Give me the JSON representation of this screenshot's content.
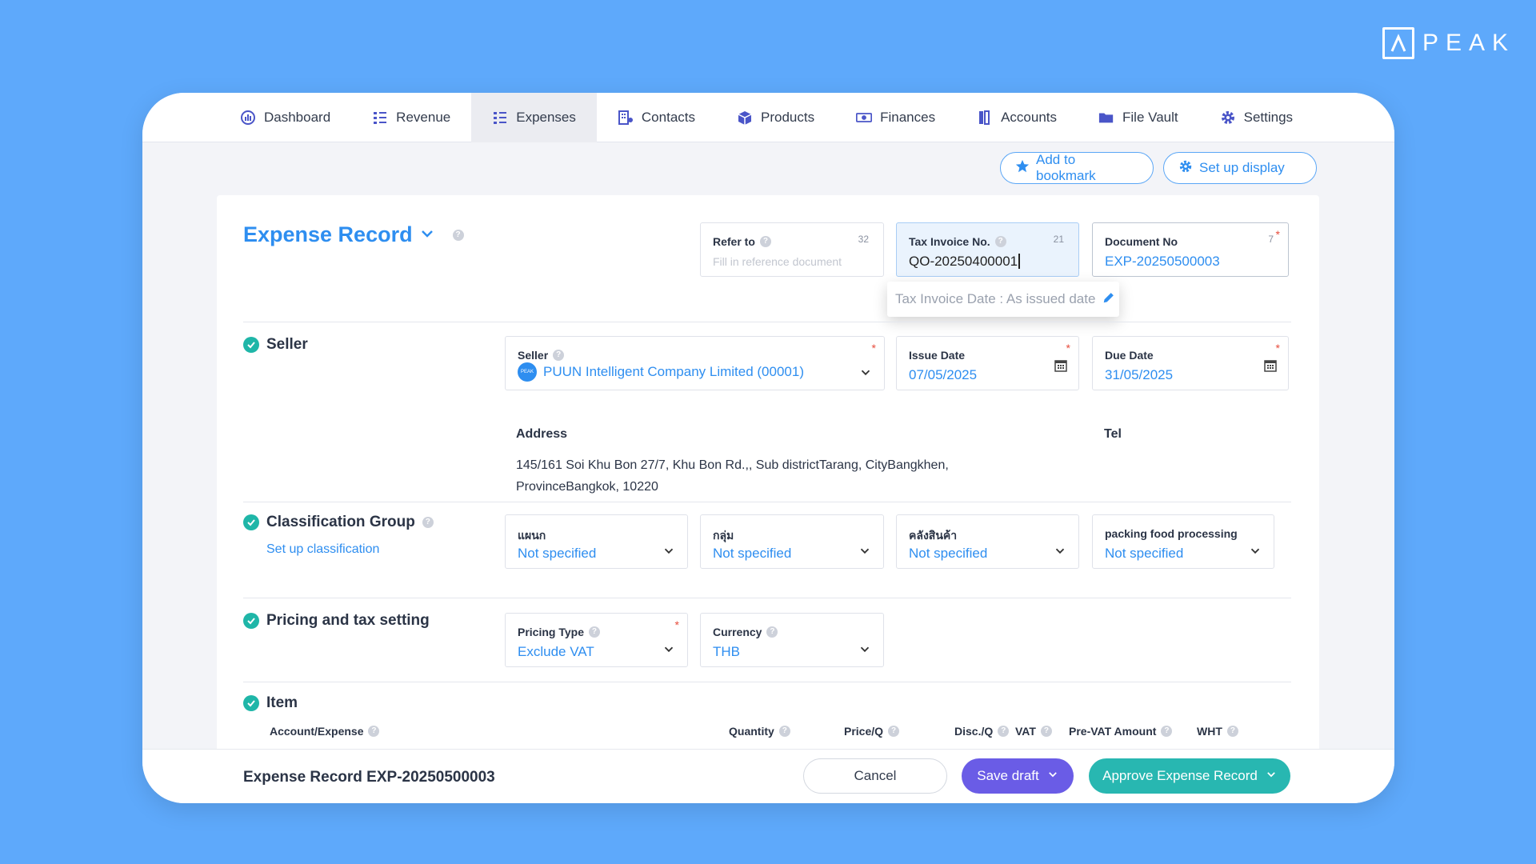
{
  "brand": {
    "logo_text": "PEAK"
  },
  "nav": {
    "items": [
      {
        "label": "Dashboard",
        "icon": "dashboard-icon"
      },
      {
        "label": "Revenue",
        "icon": "revenue-icon"
      },
      {
        "label": "Expenses",
        "icon": "expenses-icon",
        "active": true
      },
      {
        "label": "Contacts",
        "icon": "contacts-icon"
      },
      {
        "label": "Products",
        "icon": "products-icon"
      },
      {
        "label": "Finances",
        "icon": "finances-icon"
      },
      {
        "label": "Accounts",
        "icon": "accounts-icon"
      },
      {
        "label": "File Vault",
        "icon": "folder-icon"
      },
      {
        "label": "Settings",
        "icon": "gear-icon"
      }
    ]
  },
  "toolbar": {
    "bookmark_label": "Add to bookmark",
    "display_label": "Set up display"
  },
  "form": {
    "title": "Expense Record",
    "refer_to": {
      "label": "Refer to",
      "count": "32",
      "placeholder": "Fill in reference document"
    },
    "tax_invoice": {
      "label": "Tax Invoice No.",
      "count": "21",
      "value": "QO-20250400001"
    },
    "document_no": {
      "label": "Document No",
      "count": "7",
      "value": "EXP-20250500003"
    },
    "tooltip": "Tax Invoice Date : As issued date",
    "seller": {
      "section_label": "Seller",
      "field_label": "Seller",
      "avatar_text": "PEAK",
      "value": "PUUN Intelligent Company Limited (00001)"
    },
    "issue_date": {
      "label": "Issue Date",
      "value": "07/05/2025"
    },
    "due_date": {
      "label": "Due Date",
      "value": "31/05/2025"
    },
    "address": {
      "label": "Address",
      "line1": "145/161 Soi Khu Bon 27/7, Khu Bon Rd.,, Sub districtTarang, CityBangkhen,",
      "line2": "ProvinceBangkok, 10220"
    },
    "tel_label": "Tel",
    "classification": {
      "section_label": "Classification Group",
      "setup_link": "Set up classification",
      "groups": [
        {
          "label": "แผนก",
          "value": "Not specified"
        },
        {
          "label": "กลุ่ม",
          "value": "Not specified"
        },
        {
          "label": "คลังสินค้า",
          "value": "Not specified"
        },
        {
          "label": "packing food processing",
          "value": "Not specified"
        }
      ]
    },
    "pricing": {
      "section_label": "Pricing and tax setting",
      "pricing_type": {
        "label": "Pricing Type",
        "value": "Exclude VAT"
      },
      "currency": {
        "label": "Currency",
        "value": "THB"
      }
    },
    "item": {
      "section_label": "Item",
      "columns": [
        "Account/Expense",
        "Quantity",
        "Price/Q",
        "Disc./Q",
        "VAT",
        "Pre-VAT Amount",
        "WHT"
      ]
    }
  },
  "bottom": {
    "title": "Expense Record EXP-20250500003",
    "cancel_label": "Cancel",
    "draft_label": "Save draft",
    "approve_label": "Approve Expense Record"
  }
}
